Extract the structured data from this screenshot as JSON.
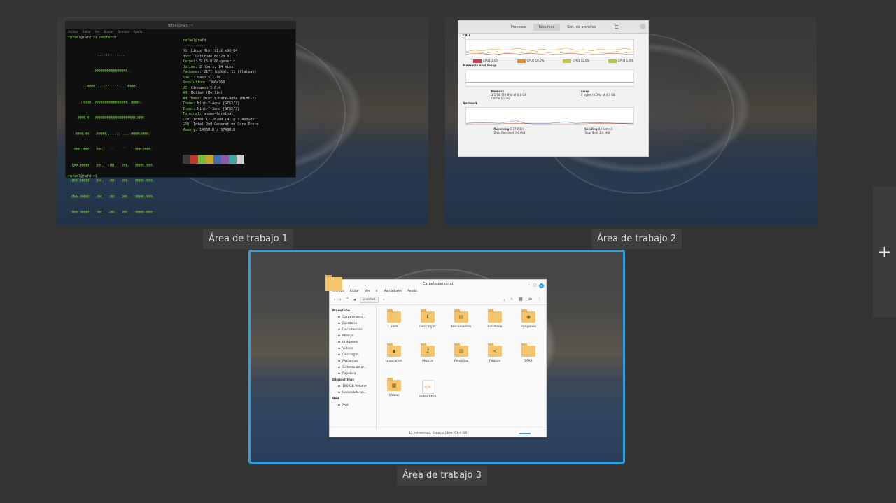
{
  "workspaces": [
    {
      "label": "Área de trabajo 1"
    },
    {
      "label": "Área de trabajo 2"
    },
    {
      "label": "Área de trabajo 3"
    }
  ],
  "add_workspace": {
    "icon": "plus-icon",
    "glyph": "+"
  },
  "colors": {
    "selected_border": "#2f9fe0",
    "background": "#333333"
  },
  "terminal": {
    "title": "rafael@rafd: ~",
    "menu": [
      "Archivo",
      "Editar",
      "Ver",
      "Buscar",
      "Terminal",
      "Ayuda"
    ],
    "command": "rafael@rafd:~$ neofetch",
    "prompt_end": "rafael@rafd:~$",
    "header": "rafael@rafd",
    "info": [
      {
        "k": "OS:",
        "v": "Linux Mint 21.2 x86_64"
      },
      {
        "k": "Host:",
        "v": "Latitude E6320 01"
      },
      {
        "k": "Kernel:",
        "v": "5.15.0-86-generic"
      },
      {
        "k": "Uptime:",
        "v": "2 hours, 14 mins"
      },
      {
        "k": "Packages:",
        "v": "2171 (dpkg), 11 (flatpak)"
      },
      {
        "k": "Shell:",
        "v": "bash 5.1.16"
      },
      {
        "k": "Resolution:",
        "v": "1366x768"
      },
      {
        "k": "DE:",
        "v": "Cinnamon 5.8.4"
      },
      {
        "k": "WM:",
        "v": "Mutter (Muffin)"
      },
      {
        "k": "WM Theme:",
        "v": "Mint-Y-Dark-Aqua (Mint-Y)"
      },
      {
        "k": "Theme:",
        "v": "Mint-Y-Aqua [GTK2/3]"
      },
      {
        "k": "Icons:",
        "v": "Mint-Y-Sand [GTK2/3]"
      },
      {
        "k": "Terminal:",
        "v": "gnome-terminal"
      },
      {
        "k": "CPU:",
        "v": "Intel i7-2620M (4) @ 3.400GHz"
      },
      {
        "k": "GPU:",
        "v": "Intel 2nd Generation Core Proce"
      },
      {
        "k": "Memory:",
        "v": "1436MiB / 3748MiB"
      }
    ],
    "palette": [
      "#3a3a3a",
      "#c0392b",
      "#6fbf3f",
      "#c9a227",
      "#3d6fb3",
      "#8e5aa8",
      "#3aa7a3",
      "#cfcfcf"
    ]
  },
  "sysmon": {
    "tabs": [
      "Procesos",
      "Recursos",
      "Sist. de archivos"
    ],
    "sections": {
      "cpu": "CPU",
      "memory": "Memoria and Swap",
      "network": "Network"
    },
    "cpu_legend": [
      {
        "label": "CPU1",
        "value": "2.0%",
        "color": "#d83b4b"
      },
      {
        "label": "CPU2",
        "value": "10.0%",
        "color": "#e68a2e"
      },
      {
        "label": "CPU3",
        "value": "12.0%",
        "color": "#c6c23a"
      },
      {
        "label": "CPU4",
        "value": "1.0%",
        "color": "#a9cf3c"
      }
    ],
    "memory": {
      "label": "Memory",
      "value": "1.1 GB (29.8%) of 4.0 GB",
      "cache": "Cache 1.2 GB"
    },
    "swap": {
      "label": "Swap",
      "value": "0 bytes (0.0%) of 4.0 GB"
    },
    "receiving": {
      "label": "Receiving",
      "rate": "1.77 KiB/s",
      "total_label": "Total Received",
      "total": "7.9 MiB"
    },
    "sending": {
      "label": "Sending",
      "rate": "84 bytes/s",
      "total_label": "Total Sent",
      "total": "1.6 MiB"
    }
  },
  "filemgr": {
    "title": "Carpeta personal",
    "menu": [
      "Archivo",
      "Editar",
      "Ver",
      "Ir",
      "Marcadores",
      "Ayuda"
    ],
    "path": "rafael",
    "sidebar": {
      "my_computer": "Mi equipo",
      "items": [
        "Carpeta pers...",
        "Escritorio",
        "Documentos",
        "Música",
        "Imágenes",
        "Vídeos",
        "Descargas",
        "Recientes",
        "Sistema de ar...",
        "Papelera"
      ],
      "devices_head": "Dispositivos",
      "devices": [
        "180 GB Volume",
        "Reservado pa..."
      ],
      "network_head": "Red",
      "network": [
        "Red"
      ]
    },
    "items": [
      {
        "name": "bash",
        "icon": "folder-icon",
        "glyph": ""
      },
      {
        "name": "Descargas",
        "icon": "download-folder-icon",
        "glyph": "⬇"
      },
      {
        "name": "Documentos",
        "icon": "documents-folder-icon",
        "glyph": "▤"
      },
      {
        "name": "Escritorio",
        "icon": "desktop-folder-icon",
        "glyph": ""
      },
      {
        "name": "Imágenes",
        "icon": "pictures-folder-icon",
        "glyph": "◉"
      },
      {
        "name": "Invocation",
        "icon": "locked-folder-icon",
        "glyph": "▪"
      },
      {
        "name": "Música",
        "icon": "music-folder-icon",
        "glyph": "♫"
      },
      {
        "name": "Plantillas",
        "icon": "templates-folder-icon",
        "glyph": "▥"
      },
      {
        "name": "Público",
        "icon": "public-folder-icon",
        "glyph": "<"
      },
      {
        "name": "SFAR",
        "icon": "folder-icon",
        "glyph": ""
      },
      {
        "name": "Vídeos",
        "icon": "videos-folder-icon",
        "glyph": "▦"
      },
      {
        "name": "index.html",
        "icon": "html-file-icon",
        "glyph": "</>"
      }
    ],
    "status": "12 elementos, Espacio libre: 91,4 GB"
  }
}
